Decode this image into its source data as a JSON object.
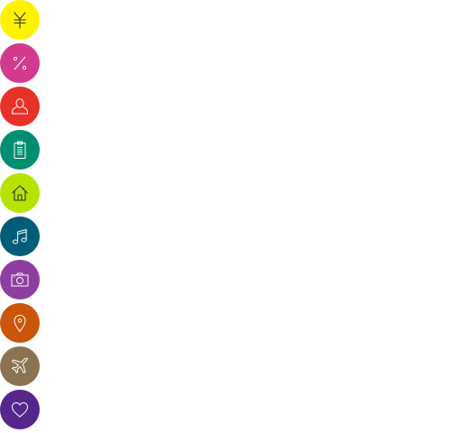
{
  "icons": [
    {
      "name": "yen-icon",
      "color": "#fff200"
    },
    {
      "name": "percent-icon",
      "color": "#d23a8e"
    },
    {
      "name": "user-icon",
      "color": "#e83228"
    },
    {
      "name": "clipboard-icon",
      "color": "#008e70"
    },
    {
      "name": "home-icon",
      "color": "#b6e400"
    },
    {
      "name": "music-icon",
      "color": "#005d78"
    },
    {
      "name": "camera-icon",
      "color": "#8e3ea0"
    },
    {
      "name": "location-pin-icon",
      "color": "#c9560a"
    },
    {
      "name": "airplane-icon",
      "color": "#8b7352"
    },
    {
      "name": "heart-icon",
      "color": "#55278c"
    }
  ]
}
